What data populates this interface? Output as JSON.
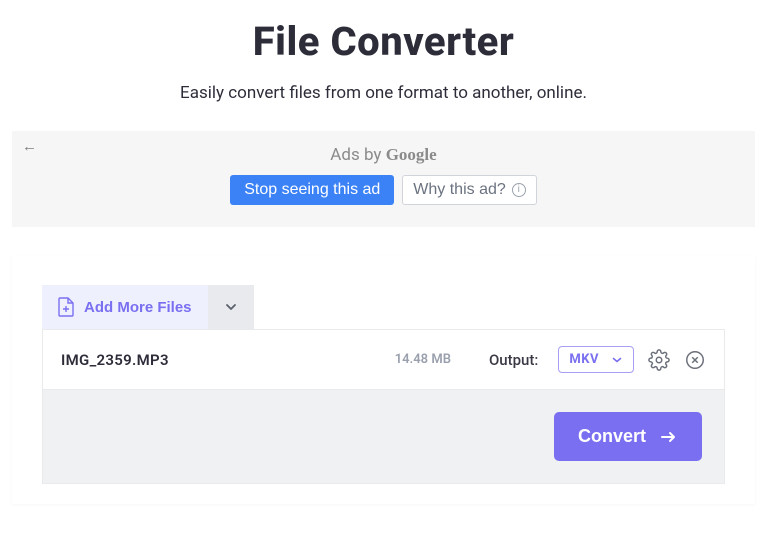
{
  "header": {
    "title": "File Converter",
    "subtitle": "Easily convert files from one format to another, online."
  },
  "ad": {
    "ads_by_prefix": "Ads by ",
    "google": "Google",
    "stop_label": "Stop seeing this ad",
    "why_label": "Why this ad?"
  },
  "toolbar": {
    "add_more_label": "Add More Files"
  },
  "files": [
    {
      "name": "IMG_2359.MP3",
      "size": "14.48 MB",
      "output_label": "Output:",
      "output_format": "MKV"
    }
  ],
  "actions": {
    "convert_label": "Convert"
  }
}
